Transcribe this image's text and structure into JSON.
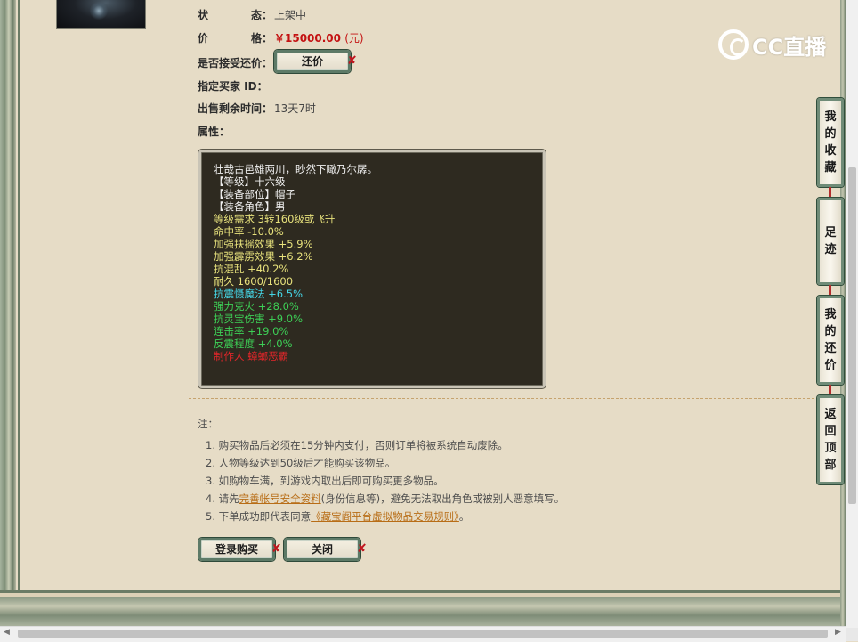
{
  "item": {
    "status_label": [
      "状",
      "态："
    ],
    "status_value": "上架中",
    "price_label": [
      "价",
      "格："
    ],
    "price_value": "￥15000.00",
    "price_unit": "(元)",
    "counter_label": "是否接受还价：",
    "counter_button": "还价",
    "buyer_label": "指定买家 ID：",
    "remaining_label": "出售剩余时间：",
    "remaining_value": "13天7时",
    "attributes_label": "属性："
  },
  "attributes": [
    {
      "text": "壮哉古邑雄两川，眇然下瞰乃尔孱。",
      "color": "white",
      "indent": false
    },
    {
      "text": "【等级】十六级",
      "color": "white",
      "indent": true
    },
    {
      "text": "【装备部位】帽子",
      "color": "white",
      "indent": true
    },
    {
      "text": "【装备角色】男",
      "color": "white",
      "indent": true
    },
    {
      "text": "等级需求 3转160级或飞升",
      "color": "yellow",
      "indent": false
    },
    {
      "text": "命中率 -10.0%",
      "color": "yellow",
      "indent": false
    },
    {
      "text": "加强扶摇效果 +5.9%",
      "color": "yellow",
      "indent": false
    },
    {
      "text": "加强霹雳效果 +6.2%",
      "color": "yellow",
      "indent": false
    },
    {
      "text": "抗混乱 +40.2%",
      "color": "yellow",
      "indent": false
    },
    {
      "text": "耐久 1600/1600",
      "color": "yellow",
      "indent": false
    },
    {
      "text": "抗震慑魔法 +6.5%",
      "color": "cyan",
      "indent": false
    },
    {
      "text": "强力克火 +28.0%",
      "color": "green",
      "indent": false
    },
    {
      "text": "抗灵宝伤害 +9.0%",
      "color": "green",
      "indent": false
    },
    {
      "text": "连击率 +19.0%",
      "color": "green",
      "indent": false
    },
    {
      "text": "反震程度 +4.0%",
      "color": "green",
      "indent": false
    },
    {
      "text": "制作人 蟑螂恶霸",
      "color": "red",
      "indent": false
    }
  ],
  "notes": {
    "head": "注：",
    "items": [
      {
        "pre": "1. 购买物品后必须在15分钟内支付，否则订单将被系统自动废除。",
        "link": "",
        "post": ""
      },
      {
        "pre": "2. 人物等级达到50级后才能购买该物品。",
        "link": "",
        "post": ""
      },
      {
        "pre": "3. 如购物车满，到游戏内取出后即可购买更多物品。",
        "link": "",
        "post": ""
      },
      {
        "pre": "4. 请先",
        "link": "完善帐号安全资料",
        "post": "(身份信息等)，避免无法取出角色或被别人恶意填写。"
      },
      {
        "pre": "5. 下单成功即代表同意",
        "link": "《藏宝阁平台虚拟物品交易规则》",
        "post": "。"
      }
    ]
  },
  "buttons": {
    "login_buy": "登录购买",
    "close": "关闭",
    "mark": "✘"
  },
  "side_tabs": [
    {
      "chars": [
        "我",
        "的",
        "收",
        "藏"
      ]
    },
    {
      "chars": [
        "足",
        "迹"
      ]
    },
    {
      "chars": [
        "我",
        "的",
        "还",
        "价"
      ]
    },
    {
      "chars": [
        "返",
        "回",
        "顶",
        "部"
      ]
    }
  ],
  "logo": {
    "text": "CC直播"
  },
  "colors": {
    "price": "#c41212",
    "button_border": "#5d7a67",
    "attr_bg": "#2e2a20",
    "yellow": "#e8e27c",
    "cyan": "#45d6e6",
    "green": "#3dcf56",
    "red": "#e3262a"
  }
}
